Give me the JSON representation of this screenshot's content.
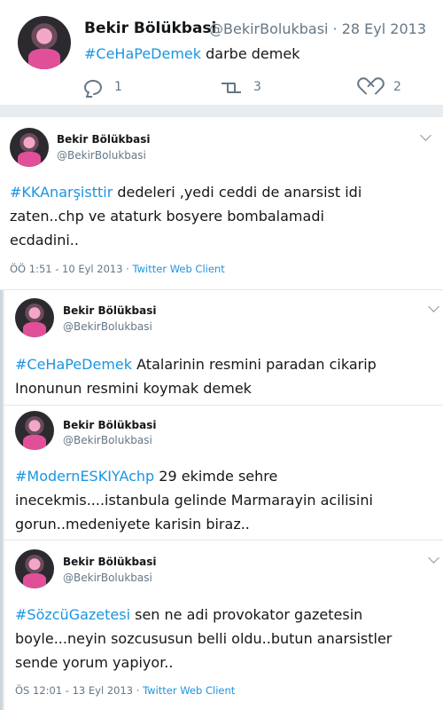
{
  "top_tweet": {
    "name": "Bekir Bölükbasi",
    "handle_date": "@BekirBolukbasi · 28 Eyl 2013",
    "hashtag": "#CeHaPeDemek",
    "text": " darbe demek",
    "reply_count": "1",
    "retweet_count": "3",
    "like_count": "2"
  },
  "tweets": [
    {
      "name": "Bekir Bölükbasi",
      "handle": "@BekirBolukbasi",
      "hashtag": "#KKAnarşisttir",
      "text_lines": [
        " dedeleri ,yedi ceddi de anarsist idi",
        "zaten..chp  ve ataturk bosyere bombalamadi",
        "ecdadini.."
      ],
      "time": "ÖÖ 1:51 - 10 Eyl 2013 · ",
      "client": "Twitter Web Client"
    },
    {
      "name": "Bekir Bölükbasi",
      "handle": "@BekirBolukbasi",
      "hashtag": "#CeHaPeDemek",
      "text_lines": [
        " Atalarinin resmini paradan cikarip",
        "Inonunun resmini koymak demek"
      ]
    },
    {
      "name": "Bekir Bölükbasi",
      "handle": "@BekirBolukbasi",
      "hashtag": "#ModernESKIYAchp",
      "text_lines": [
        " 29 ekimde sehre",
        "inecekmis....istanbula gelinde Marmarayin acilisini",
        "gorun..medeniyete karisin biraz.."
      ]
    },
    {
      "name": "Bekir Bölükbasi",
      "handle": "@BekirBolukbasi",
      "hashtag": "#SözcüGazetesi",
      "text_lines": [
        " sen ne adi provokator gazetesin",
        "boyle...neyin sozcususun belli oldu..butun anarsistler",
        "sende yorum yapiyor.."
      ],
      "time": "ÖS 12:01 - 13 Eyl 2013 · ",
      "client": "Twitter Web Client"
    }
  ]
}
